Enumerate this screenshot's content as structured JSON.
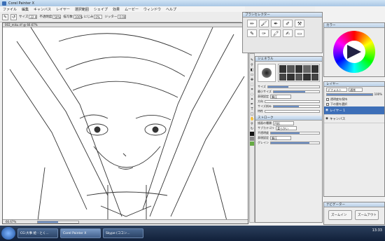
{
  "app": {
    "title": "Corel Painter X"
  },
  "menu": [
    "ファイル",
    "編集",
    "キャンバス",
    "レイヤー",
    "選択範囲",
    "シェイプ",
    "効果",
    "ムービー",
    "ウィンドウ",
    "ヘルプ"
  ],
  "props": {
    "size_label": "サイズ",
    "size_val": "22.0",
    "opacity_label": "不透明度",
    "opacity_val": "50%",
    "smooth_label": "描写数",
    "smooth_val": "100%",
    "grain_label": "にじみ",
    "grain_val": "0%",
    "jitter_label": "ジッター",
    "jitter_val": "0.00"
  },
  "canvas": {
    "title": "002_miku.rif @ 66.67%",
    "zoom": "66.67%"
  },
  "brush_selector": {
    "title": "ブラシセレクター"
  },
  "general": {
    "title": "ジェネラル",
    "size": "サイズ",
    "min_size": "最小サイズ",
    "expression": "表現設定",
    "expression_val": "筆圧",
    "direction": "方向",
    "size_step": "サイズ刻み",
    "feature": "特性",
    "opacity": "不透明度",
    "opacity_expr": "表現設定",
    "opacity_val": "筆圧",
    "grain": "グレイン",
    "grain_expr": "表現設定"
  },
  "stroke": {
    "title": "ストローク",
    "method": "描画の種類",
    "method_val": "円形",
    "subcat": "サブカテゴリ",
    "subcat_val": "柔らかい"
  },
  "color": {
    "title": "カラー"
  },
  "layers": {
    "title": "レイヤー",
    "blend": "デフォルト",
    "composite": "通常",
    "opacity": "100%",
    "preserve": "透明度を保持",
    "pick": "下の層を選択",
    "items": [
      "レイヤー 1",
      "キャンバス"
    ]
  },
  "navigator": {
    "title": "ナビゲーター",
    "zoom_out": "ズームイン",
    "zoom_in": "ズームアウト"
  },
  "taskbar": {
    "items": [
      "CG:大事 絵 - とく...",
      "Corel Painter X",
      "Skype (ココン..."
    ],
    "time": "13:33"
  },
  "progress": {
    "zoom_fill": 0.5
  }
}
